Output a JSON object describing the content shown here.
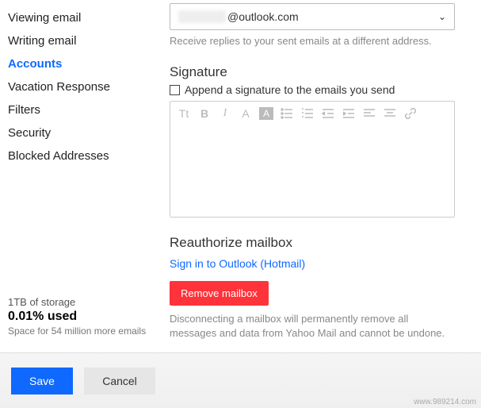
{
  "sidebar": {
    "items": [
      {
        "label": "Viewing email"
      },
      {
        "label": "Writing email"
      },
      {
        "label": "Accounts"
      },
      {
        "label": "Vacation Response"
      },
      {
        "label": "Filters"
      },
      {
        "label": "Security"
      },
      {
        "label": "Blocked Addresses"
      }
    ],
    "active_index": 2
  },
  "storage": {
    "total": "1TB of storage",
    "used": "0.01% used",
    "sub": "Space for 54 million more emails"
  },
  "reply": {
    "masked_prefix": "",
    "domain": "@outlook.com",
    "helper": "Receive replies to your sent emails at a different address."
  },
  "signature": {
    "title": "Signature",
    "checkbox_label": "Append a signature to the emails you send",
    "checked": false,
    "toolbar": {
      "text_size": "Tt",
      "bold": "B",
      "italic": "I",
      "text_color": "A",
      "highlight": "A"
    }
  },
  "reauth": {
    "title": "Reauthorize mailbox",
    "link": "Sign in to Outlook (Hotmail)",
    "remove_label": "Remove mailbox",
    "warning": "Disconnecting a mailbox will permanently remove all messages and data from Yahoo Mail and cannot be undone."
  },
  "footer": {
    "save": "Save",
    "cancel": "Cancel"
  },
  "watermark": "www.989214.com"
}
